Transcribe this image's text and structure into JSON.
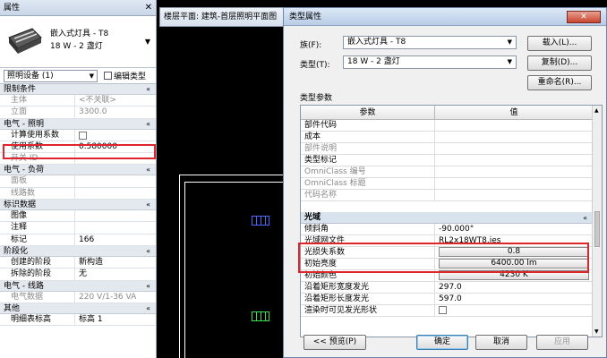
{
  "props": {
    "title": "属性",
    "close": "✕",
    "type_name": "嵌入式灯具 - T8",
    "type_sub": "18 W - 2 盏灯",
    "category": "照明设备 (1)",
    "edit_type": "编辑类型",
    "sections": [
      {
        "label": "限制条件",
        "rows": [
          {
            "k": "主体",
            "v": "<不关联>",
            "dim": true
          },
          {
            "k": "立面",
            "v": "3300.0",
            "dim": true
          }
        ]
      },
      {
        "label": "电气 - 照明",
        "rows": [
          {
            "k": "计算使用系数",
            "v": "",
            "checkbox": true
          },
          {
            "k": "使用系数",
            "v": "0.580000"
          },
          {
            "k": "开关 ID",
            "v": "",
            "dim": true
          }
        ]
      },
      {
        "label": "电气 - 负荷",
        "rows": [
          {
            "k": "面板",
            "v": "",
            "dim": true
          },
          {
            "k": "线路数",
            "v": "",
            "dim": true
          }
        ]
      },
      {
        "label": "标识数据",
        "rows": [
          {
            "k": "图像",
            "v": ""
          },
          {
            "k": "注释",
            "v": ""
          },
          {
            "k": "标记",
            "v": "166"
          }
        ]
      },
      {
        "label": "阶段化",
        "rows": [
          {
            "k": "创建的阶段",
            "v": "新构造"
          },
          {
            "k": "拆除的阶段",
            "v": "无"
          }
        ]
      },
      {
        "label": "电气 - 线路",
        "rows": [
          {
            "k": "电气数据",
            "v": "220 V/1-36 VA",
            "dim": true
          }
        ]
      },
      {
        "label": "其他",
        "rows": [
          {
            "k": "明细表标高",
            "v": "标高 1"
          }
        ]
      }
    ]
  },
  "view_tab": "楼层平面: 建筑-首层照明平面图",
  "dialog": {
    "title": "类型属性",
    "close": "✕",
    "family_label": "族(F):",
    "family_value": "嵌入式灯具 - T8",
    "type_label": "类型(T):",
    "type_value": "18 W - 2 盏灯",
    "load_btn": "载入(L)...",
    "duplicate_btn": "复制(D)...",
    "rename_btn": "重命名(R)...",
    "type_params": "类型参数",
    "col_param": "参数",
    "col_value": "值",
    "rows_top": [
      {
        "k": "部件代码",
        "v": ""
      },
      {
        "k": "成本",
        "v": ""
      },
      {
        "k": "部件说明",
        "v": "",
        "dim": true
      },
      {
        "k": "类型标记",
        "v": ""
      },
      {
        "k": "OmniClass 编号",
        "v": "",
        "dim": true
      },
      {
        "k": "OmniClass 标题",
        "v": "",
        "dim": true
      },
      {
        "k": "代码名称",
        "v": "",
        "dim": true
      }
    ],
    "section": "光域",
    "rows_bottom": [
      {
        "k": "倾斜角",
        "v": "-90.000°"
      },
      {
        "k": "光域网文件",
        "v": "RL2x18WT8.ies"
      },
      {
        "k": "光损失系数",
        "v": "0.8",
        "button": true
      },
      {
        "k": "初始亮度",
        "v": "6400.00 lm",
        "button": true
      },
      {
        "k": "初始颜色",
        "v": "4230 K",
        "button": true
      },
      {
        "k": "沿着矩形宽度发光",
        "v": "297.0"
      },
      {
        "k": "沿着矩形长度发光",
        "v": "597.0"
      },
      {
        "k": "渲染时可见发光形状",
        "v": "",
        "checkbox": true
      }
    ],
    "preview_btn": "<< 预览(P)",
    "ok_btn": "确定",
    "cancel_btn": "取消",
    "apply_btn": "应用"
  }
}
